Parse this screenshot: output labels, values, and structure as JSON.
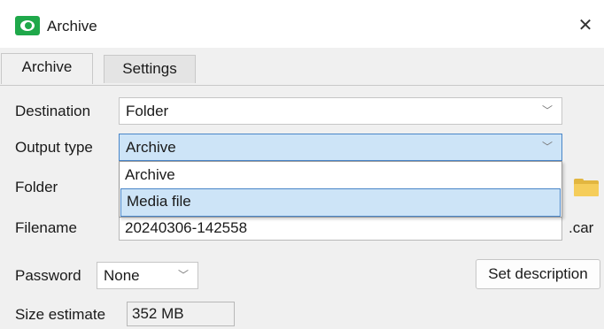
{
  "window": {
    "title": "Archive",
    "close_glyph": "✕",
    "app_icon": "eye-icon",
    "accent_color": "#1fa84a"
  },
  "tabs": [
    {
      "label": "Archive",
      "active": true
    },
    {
      "label": "Settings",
      "active": false
    }
  ],
  "form": {
    "destination": {
      "label": "Destination",
      "value": "Folder"
    },
    "output_type": {
      "label": "Output type",
      "value": "Archive",
      "options": [
        "Archive",
        "Media file"
      ],
      "highlighted_option": "Media file"
    },
    "folder": {
      "label": "Folder",
      "value": "",
      "browse_icon": "folder-icon"
    },
    "filename": {
      "label": "Filename",
      "value": "20240306-142558",
      "extension": ".car"
    },
    "password": {
      "label": "Password",
      "value": "None"
    },
    "set_description_button": "Set description",
    "size_estimate": {
      "label": "Size estimate",
      "value": "352 MB"
    }
  },
  "chevron_glyph": "﹀"
}
